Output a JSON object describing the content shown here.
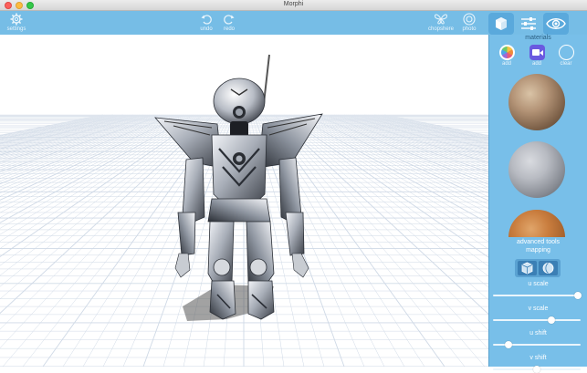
{
  "window": {
    "title": "Morphi"
  },
  "toolbar": {
    "settings_label": "settings",
    "undo_label": "undo",
    "redo_label": "redo",
    "chopshere_label": "chopshere",
    "photo_label": "photo"
  },
  "panel": {
    "materials_label": "materials",
    "add_photo_label": "add",
    "add_camera_label": "add",
    "clear_label": "clear",
    "advanced_tools_label": "advanced tools",
    "mapping_label": "mapping",
    "sliders": [
      {
        "label": "u scale",
        "value": 0.97
      },
      {
        "label": "v scale",
        "value": 0.67
      },
      {
        "label": "u shift",
        "value": 0.18
      },
      {
        "label": "v shift",
        "value": 0.5
      }
    ]
  },
  "colors": {
    "toolbar": "#76bde6",
    "panel": "#78bfe9",
    "active_tab": "#5aa9dc",
    "grid": "#cfd9e6"
  },
  "icons": [
    "gear-icon",
    "undo-icon",
    "redo-icon",
    "butterfly-icon",
    "camera-icon",
    "cube-icon",
    "sliders-icon",
    "eye-icon",
    "photos-icon",
    "video-camera-icon",
    "clear-circle-icon"
  ]
}
